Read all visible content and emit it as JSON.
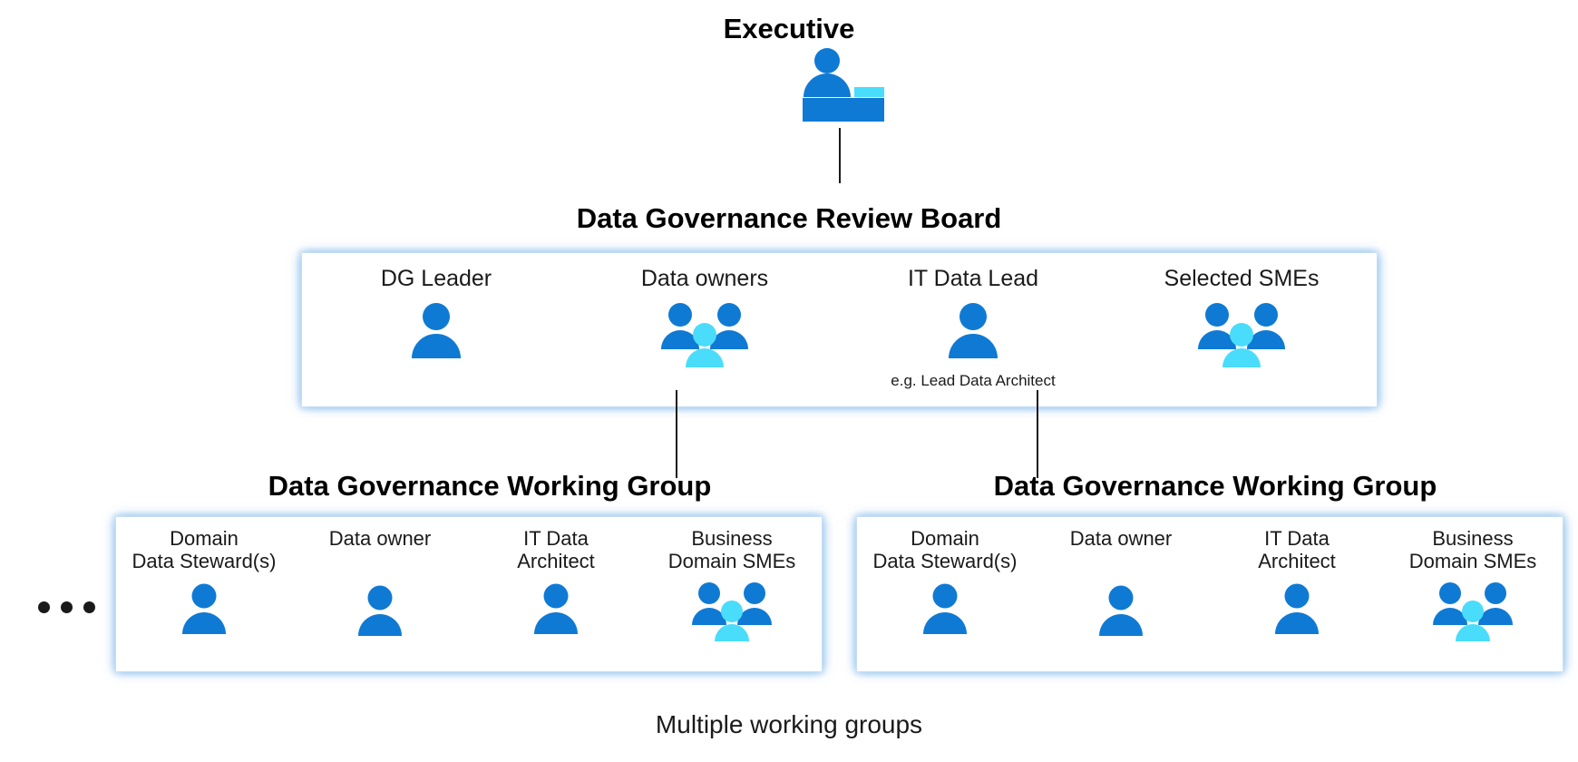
{
  "colors": {
    "person_blue": "#0f7ad4",
    "person_cyan": "#4adcfb",
    "desk_blue": "#0f7ad4",
    "desk_accent_cyan": "#4adcfb",
    "line": "#1a1a1a",
    "panel_bg": "#ffffff",
    "panel_glow": "#9ac4ee",
    "text": "#1a1a1a",
    "background": "#ffffff"
  },
  "executive": {
    "title": "Executive",
    "icon": "executive-at-desk-icon"
  },
  "review_board": {
    "title": "Data Governance Review Board",
    "members": [
      {
        "label": "DG Leader",
        "sublabel": "",
        "icon": "person-icon"
      },
      {
        "label": "Data owners",
        "sublabel": "",
        "icon": "people-group-icon"
      },
      {
        "label": "IT Data Lead",
        "sublabel": "e.g. Lead Data Architect",
        "icon": "person-icon"
      },
      {
        "label": "Selected SMEs",
        "sublabel": "",
        "icon": "people-group-icon"
      }
    ]
  },
  "working_groups": [
    {
      "title": "Data Governance Working Group",
      "members": [
        {
          "label": "Domain\nData Steward(s)",
          "icon": "person-icon"
        },
        {
          "label": "Data owner",
          "icon": "person-icon"
        },
        {
          "label": "IT Data\nArchitect",
          "icon": "person-icon"
        },
        {
          "label": "Business\nDomain SMEs",
          "icon": "people-group-icon"
        }
      ]
    },
    {
      "title": "Data Governance Working Group",
      "members": [
        {
          "label": "Domain\nData Steward(s)",
          "icon": "person-icon"
        },
        {
          "label": "Data owner",
          "icon": "person-icon"
        },
        {
          "label": "IT Data\nArchitect",
          "icon": "person-icon"
        },
        {
          "label": "Business\nDomain SMEs",
          "icon": "people-group-icon"
        }
      ]
    }
  ],
  "more_groups_indicator": {
    "icon": "ellipsis-icon",
    "meaning": "more working groups"
  },
  "caption": "Multiple working groups"
}
